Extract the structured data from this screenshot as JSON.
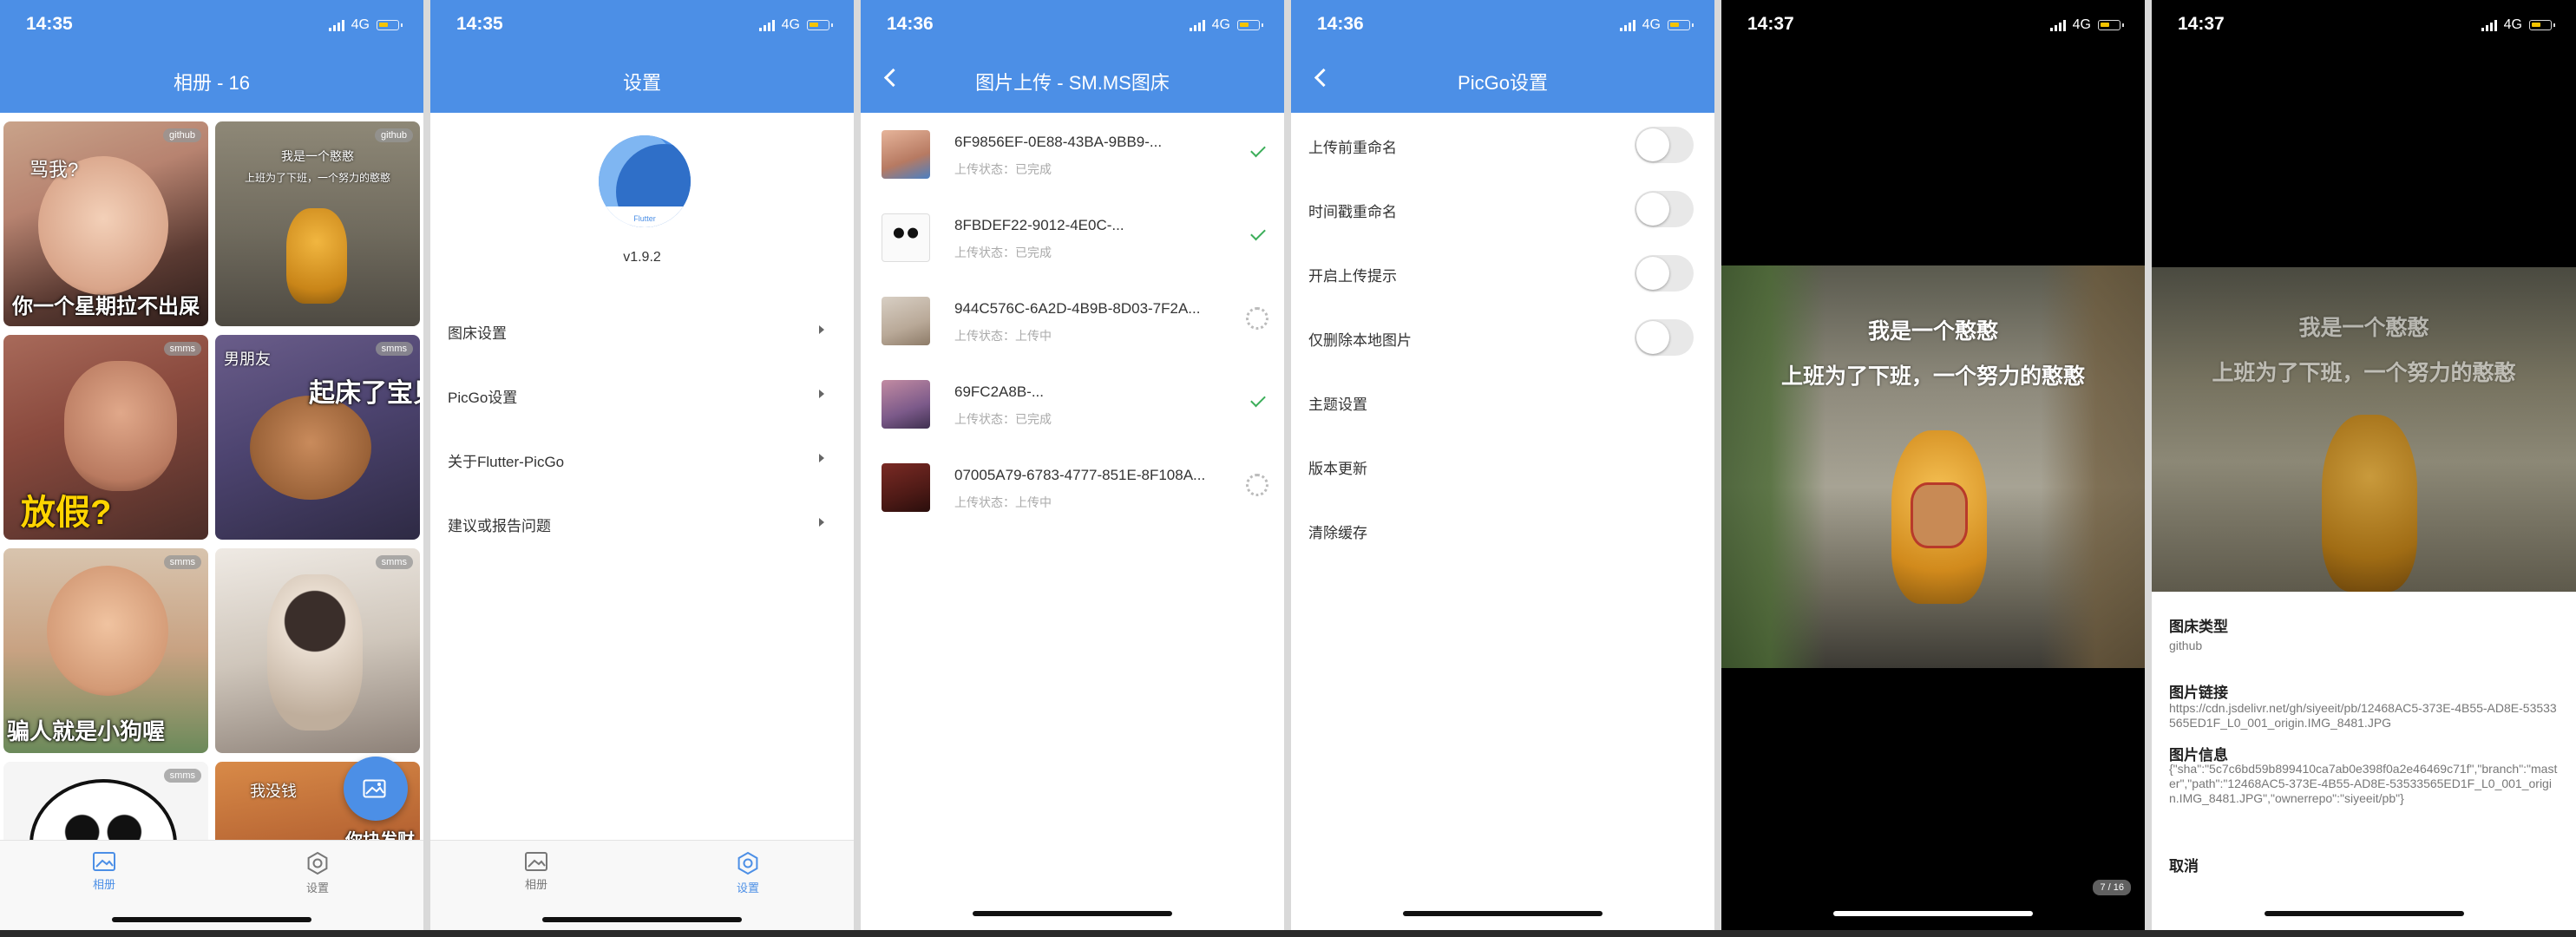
{
  "panel1": {
    "time": "14:35",
    "network": "4G",
    "title": "相册 - 16",
    "tiles": [
      {
        "tag": "github",
        "caption_top": "骂我?",
        "caption": "你一个星期拉不出屎"
      },
      {
        "tag": "github",
        "line1": "我是一个憨憨",
        "line2": "上班为了下班，一个努力的憨憨"
      },
      {
        "tag": "smms",
        "caption": "放假?"
      },
      {
        "tag": "smms",
        "caption_top": "男朋友",
        "caption": "起床了宝贝"
      },
      {
        "tag": "smms",
        "caption": "骗人就是小狗喔"
      },
      {
        "tag": "smms"
      },
      {
        "tag": "smms"
      },
      {
        "tag": "",
        "caption_top": "我没钱",
        "caption": "你块发财"
      }
    ],
    "nav_album": "相册",
    "nav_settings": "设置"
  },
  "panel2": {
    "time": "14:35",
    "network": "4G",
    "title": "设置",
    "logo_text": "Flutter",
    "version": "v1.9.2",
    "menu": [
      "图床设置",
      "PicGo设置",
      "关于Flutter-PicGo",
      "建议或报告问题"
    ],
    "nav_album": "相册",
    "nav_settings": "设置"
  },
  "panel3": {
    "time": "14:36",
    "network": "4G",
    "title": "图片上传 - SM.MS图床",
    "uploads": [
      {
        "name": "6F9856EF-0E88-43BA-9BB9-...",
        "status": "上传状态：已完成",
        "done": true
      },
      {
        "name": "8FBDEF22-9012-4E0C-...",
        "status": "上传状态：已完成",
        "done": true
      },
      {
        "name": "944C576C-6A2D-4B9B-8D03-7F2A...",
        "status": "上传状态：上传中",
        "done": false
      },
      {
        "name": "69FC2A8B-...",
        "status": "上传状态：已完成",
        "done": true
      },
      {
        "name": "07005A79-6783-4777-851E-8F108A...",
        "status": "上传状态：上传中",
        "done": false
      }
    ]
  },
  "panel4": {
    "time": "14:36",
    "network": "4G",
    "title": "PicGo设置",
    "toggles": [
      "上传前重命名",
      "时间戳重命名",
      "开启上传提示",
      "仅删除本地图片"
    ],
    "items": [
      "主题设置",
      "版本更新",
      "清除缓存"
    ]
  },
  "panel5": {
    "time": "14:37",
    "network": "4G",
    "line1": "我是一个憨憨",
    "line2": "上班为了下班，一个努力的憨憨",
    "page": "7 / 16"
  },
  "panel6": {
    "time": "14:37",
    "network": "4G",
    "line1": "我是一个憨憨",
    "line2": "上班为了下班，一个努力的憨憨",
    "type_label": "图床类型",
    "type_value": "github",
    "link_label": "图片链接",
    "link_value": "https://cdn.jsdelivr.net/gh/siyeeit/pb/12468AC5-373E-4B55-AD8E-53533565ED1F_L0_001_origin.IMG_8481.JPG",
    "info_label": "图片信息",
    "info_value": "{\"sha\":\"5c7c6bd59b899410ca7ab0e398f0a2e46469c71f\",\"branch\":\"master\",\"path\":\"12468AC5-373E-4B55-AD8E-53533565ED1F_L0_001_origin.IMG_8481.JPG\",\"ownerrepo\":\"siyeeit/pb\"}",
    "cancel": "取消"
  },
  "colors": {
    "accent": "#4c8fe6",
    "success": "#3cae5a",
    "battery": "#f5c400"
  }
}
